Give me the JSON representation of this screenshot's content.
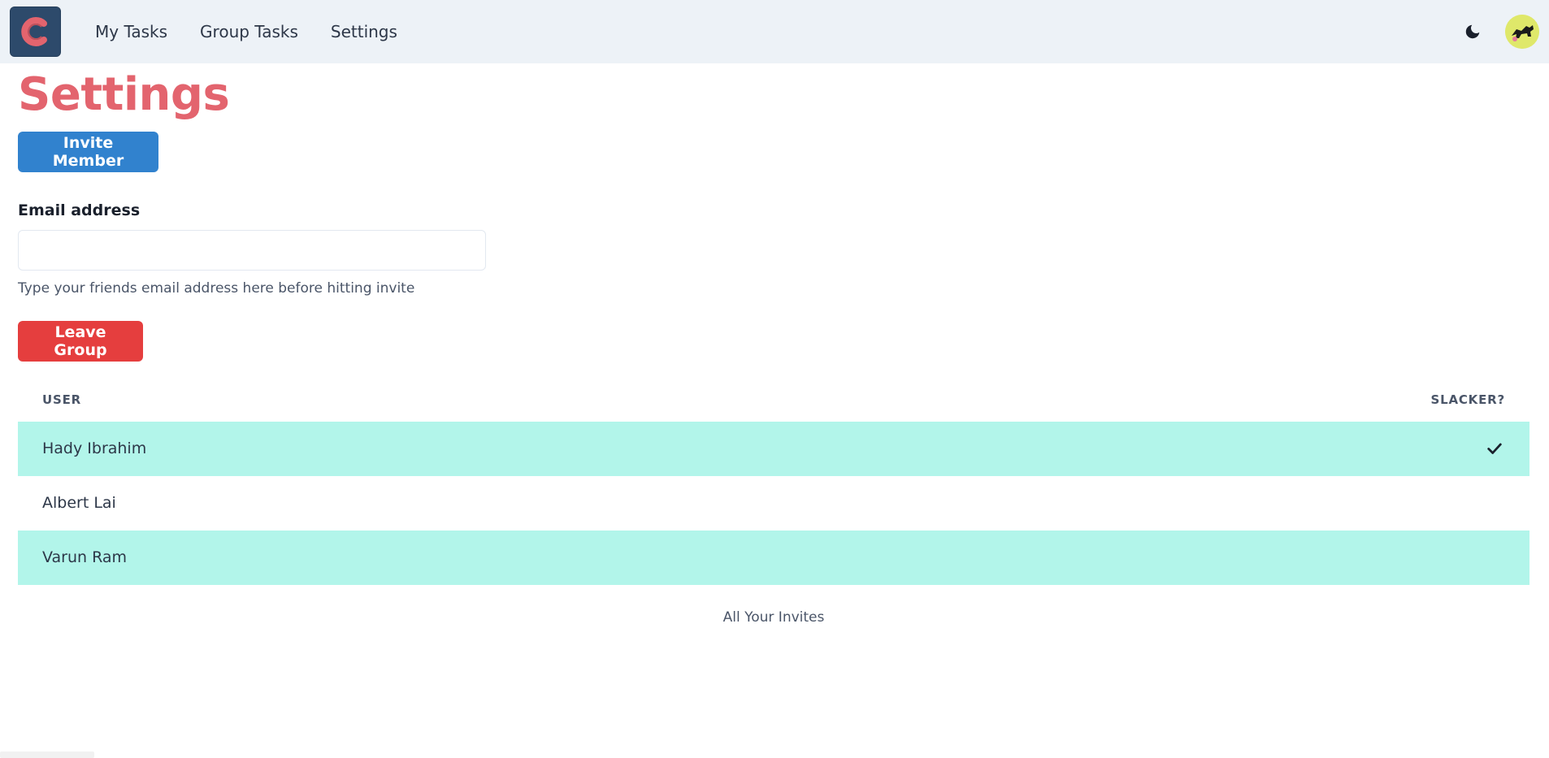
{
  "nav": {
    "logo_icon": "c-logo-icon",
    "links": [
      "My Tasks",
      "Group Tasks",
      "Settings"
    ],
    "theme_icon": "moon-icon",
    "avatar_icon": "avatar-icon"
  },
  "page": {
    "title": "Settings",
    "invite_button": "Invite Member",
    "email_label": "Email address",
    "email_value": "",
    "email_helper": "Type your friends email address here before hitting invite",
    "leave_button": "Leave Group"
  },
  "table": {
    "headers": [
      "USER",
      "SLACKER?"
    ],
    "rows": [
      {
        "user": "Hady Ibrahim",
        "slacker": true
      },
      {
        "user": "Albert Lai",
        "slacker": false
      },
      {
        "user": "Varun Ram",
        "slacker": false
      }
    ],
    "caption": "All Your Invites"
  },
  "colors": {
    "title": "#e3646e",
    "invite": "#3182ce",
    "leave": "#e53e3e",
    "stripe": "#b2f5ea",
    "navbar": "#edf2f7"
  }
}
